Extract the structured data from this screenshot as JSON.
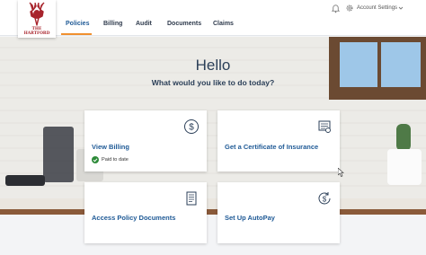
{
  "brand": {
    "logo_text_line1": "THE",
    "logo_text_line2": "HARTFORD"
  },
  "nav": {
    "tabs": [
      {
        "label": "Policies",
        "active": true
      },
      {
        "label": "Billing",
        "active": false
      },
      {
        "label": "Audit",
        "active": false
      },
      {
        "label": "Documents",
        "active": false
      },
      {
        "label": "Claims",
        "active": false
      }
    ],
    "accent_color": "#f0902f"
  },
  "header": {
    "account_label": "Account Settings",
    "icons": [
      "bell-icon",
      "gear-icon",
      "chevron-down-icon"
    ]
  },
  "hero": {
    "greeting": "Hello",
    "prompt": "What would you like to do today?"
  },
  "cards": [
    {
      "title": "View Billing",
      "icon": "dollar-circle-icon",
      "status": "Paid to date",
      "status_icon": "check-circle-icon"
    },
    {
      "title": "Get a Certificate of Insurance",
      "icon": "certificate-icon"
    },
    {
      "title": "Access Policy Documents",
      "icon": "document-icon"
    },
    {
      "title": "Set Up AutoPay",
      "icon": "autopay-dollar-icon"
    }
  ],
  "colors": {
    "link_blue": "#1f5a96",
    "heading_navy": "#2b3f58",
    "brand_red": "#a8242c",
    "success_green": "#2e8b3a"
  }
}
